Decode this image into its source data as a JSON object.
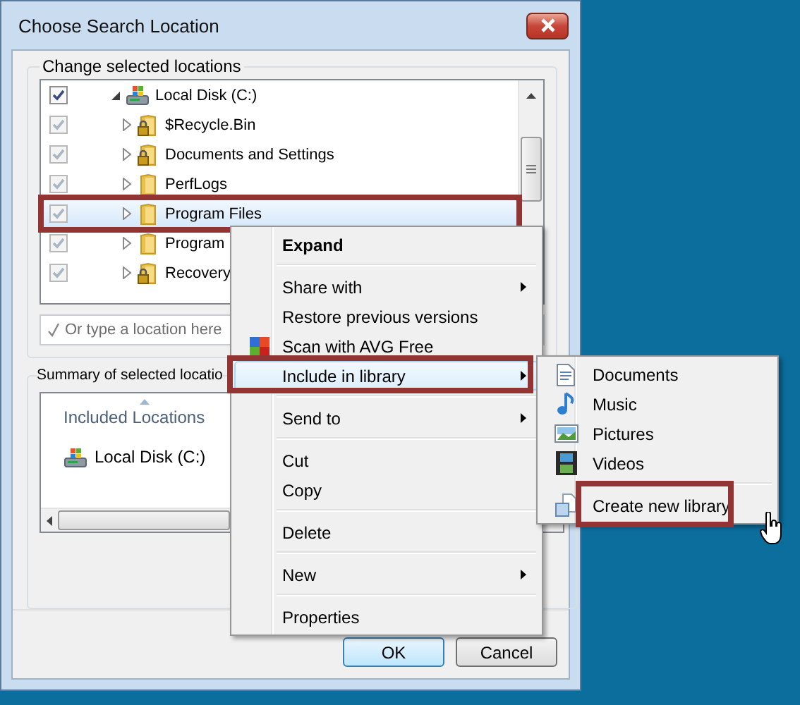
{
  "window": {
    "title": "Choose Search Location"
  },
  "locations": {
    "label": "Change selected locations",
    "tree": [
      {
        "label": "Local Disk (C:)",
        "kind": "drive",
        "checked": true,
        "disabled": false,
        "expanded": true,
        "selected": false,
        "annotated": false,
        "children": [
          {
            "label": "$Recycle.Bin",
            "kind": "locked-folder",
            "checked": true,
            "disabled": true,
            "expanded": false,
            "selected": false,
            "annotated": false
          },
          {
            "label": "Documents and Settings",
            "kind": "locked-folder",
            "checked": true,
            "disabled": true,
            "expanded": false,
            "selected": false,
            "annotated": false
          },
          {
            "label": "PerfLogs",
            "kind": "folder",
            "checked": true,
            "disabled": true,
            "expanded": false,
            "selected": false,
            "annotated": false
          },
          {
            "label": "Program Files",
            "kind": "folder",
            "checked": true,
            "disabled": true,
            "expanded": false,
            "selected": true,
            "annotated": true
          },
          {
            "label": "Program",
            "kind": "folder",
            "checked": true,
            "disabled": true,
            "expanded": false,
            "selected": false,
            "annotated": false
          },
          {
            "label": "Recovery",
            "kind": "locked-folder",
            "checked": true,
            "disabled": true,
            "expanded": false,
            "selected": false,
            "annotated": false
          }
        ]
      }
    ],
    "location_field": {
      "placeholder": "Or type a location here"
    }
  },
  "summary": {
    "label": "Summary of selected locatio",
    "column": "Included Locations",
    "items": [
      {
        "label": "Local Disk (C:)",
        "kind": "drive"
      }
    ]
  },
  "buttons": [
    {
      "label": "OK",
      "default": true
    },
    {
      "label": "Cancel",
      "default": false
    }
  ],
  "context_menu": {
    "items": [
      {
        "kind": "item",
        "label": "Expand",
        "bold": true,
        "submenu": false,
        "highlighted": false,
        "annotated": false
      },
      {
        "kind": "separator"
      },
      {
        "kind": "item",
        "label": "Share with",
        "bold": false,
        "submenu": true,
        "highlighted": false,
        "annotated": false
      },
      {
        "kind": "item",
        "label": "Restore previous versions",
        "bold": false,
        "submenu": false,
        "highlighted": false,
        "annotated": false
      },
      {
        "kind": "icon-item",
        "label": "Scan with AVG Free",
        "bold": false,
        "submenu": false,
        "highlighted": false,
        "annotated": false
      },
      {
        "kind": "item",
        "label": "Include in library",
        "bold": false,
        "submenu": true,
        "highlighted": true,
        "annotated": true
      },
      {
        "kind": "separator"
      },
      {
        "kind": "item",
        "label": "Send to",
        "bold": false,
        "submenu": true,
        "highlighted": false,
        "annotated": false
      },
      {
        "kind": "separator"
      },
      {
        "kind": "item",
        "label": "Cut",
        "bold": false,
        "submenu": false,
        "highlighted": false,
        "annotated": false
      },
      {
        "kind": "item",
        "label": "Copy",
        "bold": false,
        "submenu": false,
        "highlighted": false,
        "annotated": false
      },
      {
        "kind": "separator"
      },
      {
        "kind": "item",
        "label": "Delete",
        "bold": false,
        "submenu": false,
        "highlighted": false,
        "annotated": false
      },
      {
        "kind": "separator"
      },
      {
        "kind": "item",
        "label": "New",
        "bold": false,
        "submenu": true,
        "highlighted": false,
        "annotated": false
      },
      {
        "kind": "separator"
      },
      {
        "kind": "item",
        "label": "Properties",
        "bold": false,
        "submenu": false,
        "highlighted": false,
        "annotated": false
      }
    ]
  },
  "library_menu": {
    "items": [
      {
        "kind": "documents",
        "label": "Documents",
        "annotated": false
      },
      {
        "kind": "music",
        "label": "Music",
        "annotated": false
      },
      {
        "kind": "pictures",
        "label": "Pictures",
        "annotated": false
      },
      {
        "kind": "videos",
        "label": "Videos",
        "annotated": false
      },
      {
        "kind": "separator"
      },
      {
        "kind": "new-library",
        "label": "Create new library",
        "annotated": true
      }
    ]
  }
}
